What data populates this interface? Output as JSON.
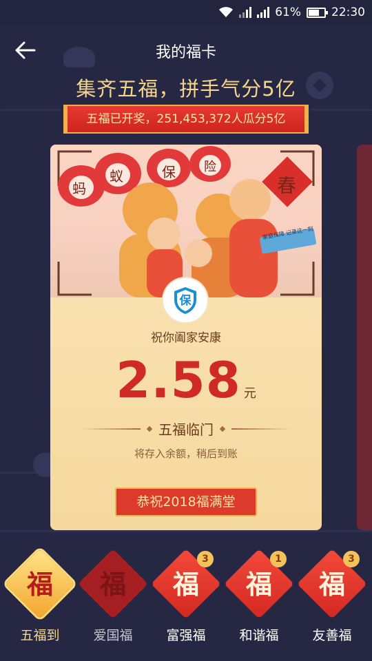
{
  "status_bar": {
    "battery": "61%",
    "time": "22:30"
  },
  "header": {
    "title": "我的福卡"
  },
  "headline": "集齐五福，拼手气分5亿",
  "ribbon": "五福已开奖，251,453,372人瓜分5亿",
  "card": {
    "illustration_text": [
      "蚂",
      "蚁",
      "保",
      "险",
      "春",
      "家庭保障 记录这一刻"
    ],
    "badge_char": "保",
    "wish": "祝你阖家安康",
    "amount": "2.58",
    "unit": "元",
    "subtitle": "五福临门",
    "note": "将存入余额，稍后到账",
    "congrats_button": "恭祝2018福满堂"
  },
  "fu_cards": [
    {
      "glyph": "福",
      "label": "五福到",
      "count": ""
    },
    {
      "glyph": "福",
      "label": "爱国福",
      "count": ""
    },
    {
      "glyph": "福",
      "label": "富强福",
      "count": "3"
    },
    {
      "glyph": "福",
      "label": "和谐福",
      "count": "1"
    },
    {
      "glyph": "福",
      "label": "友善福",
      "count": "3"
    }
  ],
  "colors": {
    "background": "#262843",
    "gold_text": "#f6d58c",
    "red": "#cf2a24",
    "card": "#fbe6bc"
  }
}
